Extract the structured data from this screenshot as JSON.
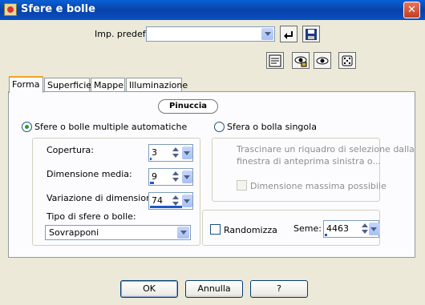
{
  "window": {
    "title": "Sfere e bolle"
  },
  "preset": {
    "label": "Imp. predef.:",
    "value": ""
  },
  "tabs": [
    "Forma",
    "Superficie",
    "Mappe",
    "Illuminazione"
  ],
  "badge": "Pinuccia",
  "auto_mode": {
    "label": "Sfere o bolle multiple automatiche",
    "selected": true,
    "coverage": {
      "label": "Copertura:",
      "value": "3",
      "level": 0.03
    },
    "avg_size": {
      "label": "Dimensione media:",
      "value": "9",
      "level": 0.09
    },
    "size_variation": {
      "label": "Variazione di dimensione:",
      "value": "74",
      "level": 0.74
    },
    "type": {
      "label": "Tipo di sfere o bolle:",
      "value": "Sovrapponi"
    }
  },
  "single_mode": {
    "label": "Sfera o bolla singola",
    "selected": false,
    "hint": [
      "Trascinare un riquadro di selezione dalla",
      "finestra di anteprima sinistra o..."
    ],
    "max_size_label": "Dimensione massima possibile"
  },
  "randomize": {
    "label": "Randomizza",
    "checked": false
  },
  "seed": {
    "label": "Seme:",
    "value": "4463",
    "level": 0.05
  },
  "buttons": {
    "ok": "OK",
    "cancel": "Annulla",
    "help": "?"
  },
  "colors": {
    "titlebar": "#0842a8",
    "tab_active_accent": "#f0a428",
    "slider_fill": "#1c58c8",
    "radio_on": "#21a121"
  }
}
